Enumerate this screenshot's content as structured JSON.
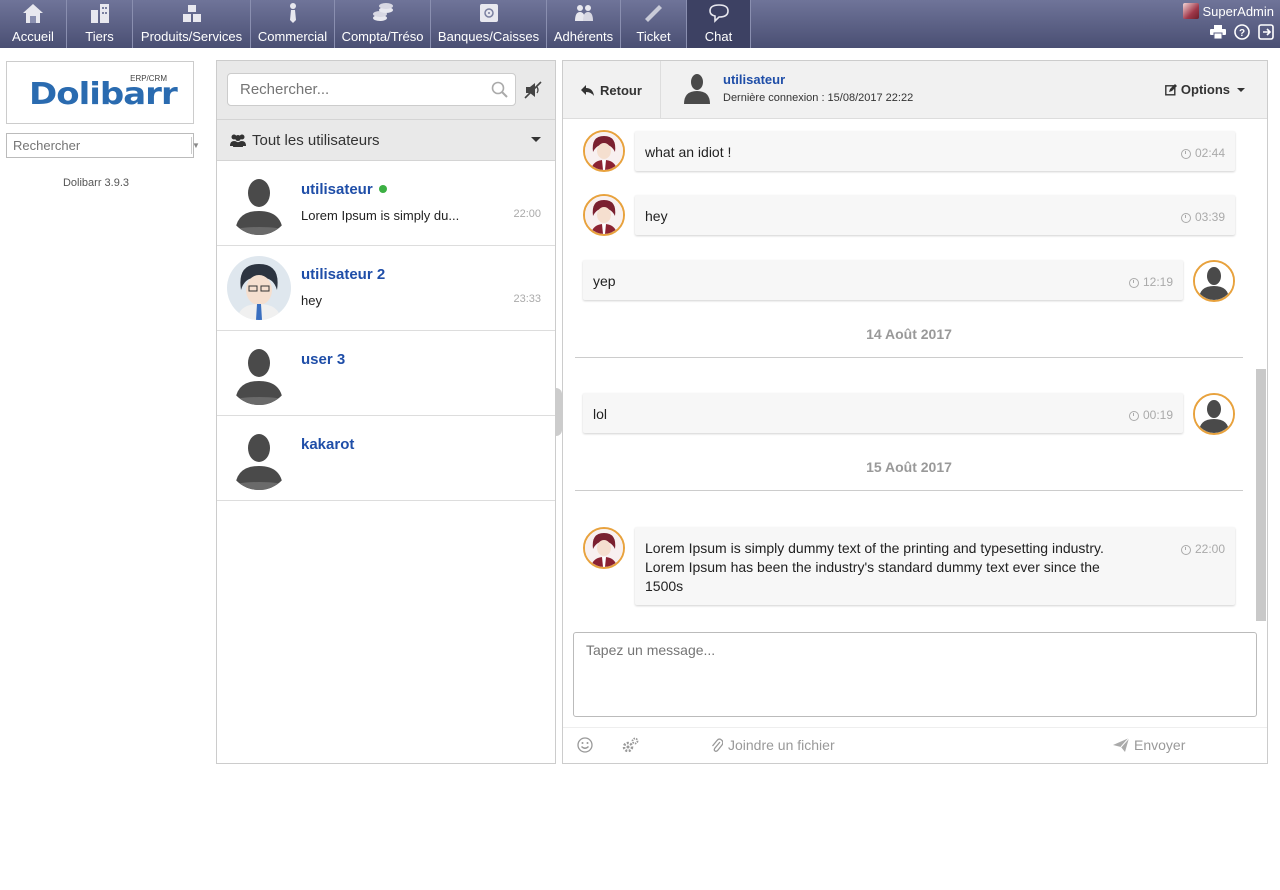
{
  "nav": {
    "items": [
      {
        "label": "Accueil",
        "icon": "home-icon"
      },
      {
        "label": "Tiers",
        "icon": "buildings-icon"
      },
      {
        "label": "Produits/Services",
        "icon": "boxes-icon"
      },
      {
        "label": "Commercial",
        "icon": "tie-icon"
      },
      {
        "label": "Compta/Tréso",
        "icon": "coins-icon"
      },
      {
        "label": "Banques/Caisses",
        "icon": "safe-icon"
      },
      {
        "label": "Adhérents",
        "icon": "members-icon"
      },
      {
        "label": "Ticket",
        "icon": "ticket-icon"
      },
      {
        "label": "Chat",
        "icon": "chat-icon"
      }
    ],
    "active": "Chat",
    "user": "SuperAdmin"
  },
  "sidebar": {
    "logo": "Dolibarr",
    "logo_sub": "ERP/CRM",
    "search_placeholder": "Rechercher",
    "version": "Dolibarr 3.9.3"
  },
  "user_list": {
    "search_placeholder": "Rechercher...",
    "filter_label": "Tout les utilisateurs",
    "users": [
      {
        "name": "utilisateur",
        "preview": "Lorem Ipsum is simply du...",
        "time": "22:00",
        "online": true
      },
      {
        "name": "utilisateur 2",
        "preview": "hey",
        "time": "23:33",
        "online": false
      },
      {
        "name": "user 3",
        "preview": "",
        "time": "",
        "online": false
      },
      {
        "name": "kakarot",
        "preview": "",
        "time": "",
        "online": false
      }
    ]
  },
  "chat": {
    "back_label": "Retour",
    "contact_name": "utilisateur",
    "last_connection": "Dernière connexion : 15/08/2017 22:22",
    "options_label": "Options",
    "messages": [
      {
        "text": "what an idiot !",
        "time": "02:44",
        "side": "left"
      },
      {
        "text": "hey",
        "time": "03:39",
        "side": "left"
      },
      {
        "text": "yep",
        "time": "12:19",
        "side": "right"
      },
      {
        "date": "14 Août 2017"
      },
      {
        "text": "lol",
        "time": "00:19",
        "side": "right"
      },
      {
        "date": "15 Août 2017"
      },
      {
        "text": "Lorem Ipsum is simply dummy text of the printing and typesetting industry. Lorem Ipsum has been the industry's standard dummy text ever since the 1500s",
        "time": "22:00",
        "side": "left"
      }
    ],
    "compose_placeholder": "Tapez un message...",
    "attach_label": "Joindre un fichier",
    "send_label": "Envoyer"
  },
  "colors": {
    "nav_bg": "#5c6185",
    "link_blue": "#1f4ea8",
    "avatar_ring": "#e8a23d",
    "online": "#3cb043"
  }
}
